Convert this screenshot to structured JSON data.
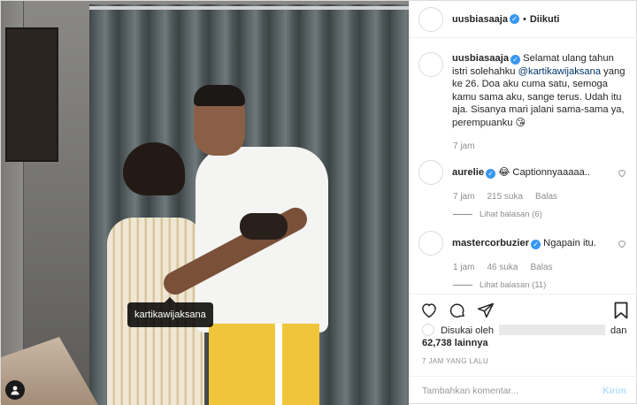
{
  "photo": {
    "tag_label": "kartikawijaksana"
  },
  "header": {
    "username": "uusbiasaaja",
    "dot": "•",
    "follow_label": "Diikuti"
  },
  "caption": {
    "username": "uusbiasaaja",
    "text_before": "Selamat ulang tahun istri solehahku ",
    "mention": "@kartikawijaksana",
    "text_after": " yang ke 26. Doa aku cuma satu, semoga kamu sama aku, sange terus. Udah itu aja. Sisanya mari jalani sama-sama ya, perempuanku 😘",
    "time": "7 jam"
  },
  "comments": [
    {
      "username": "aurelie",
      "text": "😂 Captionnyaaaaa..",
      "time": "7 jam",
      "likes": "215 suka",
      "reply": "Balas",
      "view_replies": "Lihat balasan (6)"
    },
    {
      "username": "mastercorbuzier",
      "text": "Ngapain itu.",
      "time": "1 jam",
      "likes": "46 suka",
      "reply": "Balas",
      "view_replies": "Lihat balasan (11)"
    }
  ],
  "likes": {
    "prefix": "Disukai oleh",
    "joiner": "dan",
    "count": "62,738 lainnya"
  },
  "posted_ago": "7 JAM YANG LALU",
  "comment_box": {
    "placeholder": "Tambahkan komentar...",
    "post_label": "Kirim"
  },
  "colors": {
    "verified": "#3897f0",
    "post_button_disabled": "#b2dffc",
    "muted": "#8e8e8e"
  }
}
